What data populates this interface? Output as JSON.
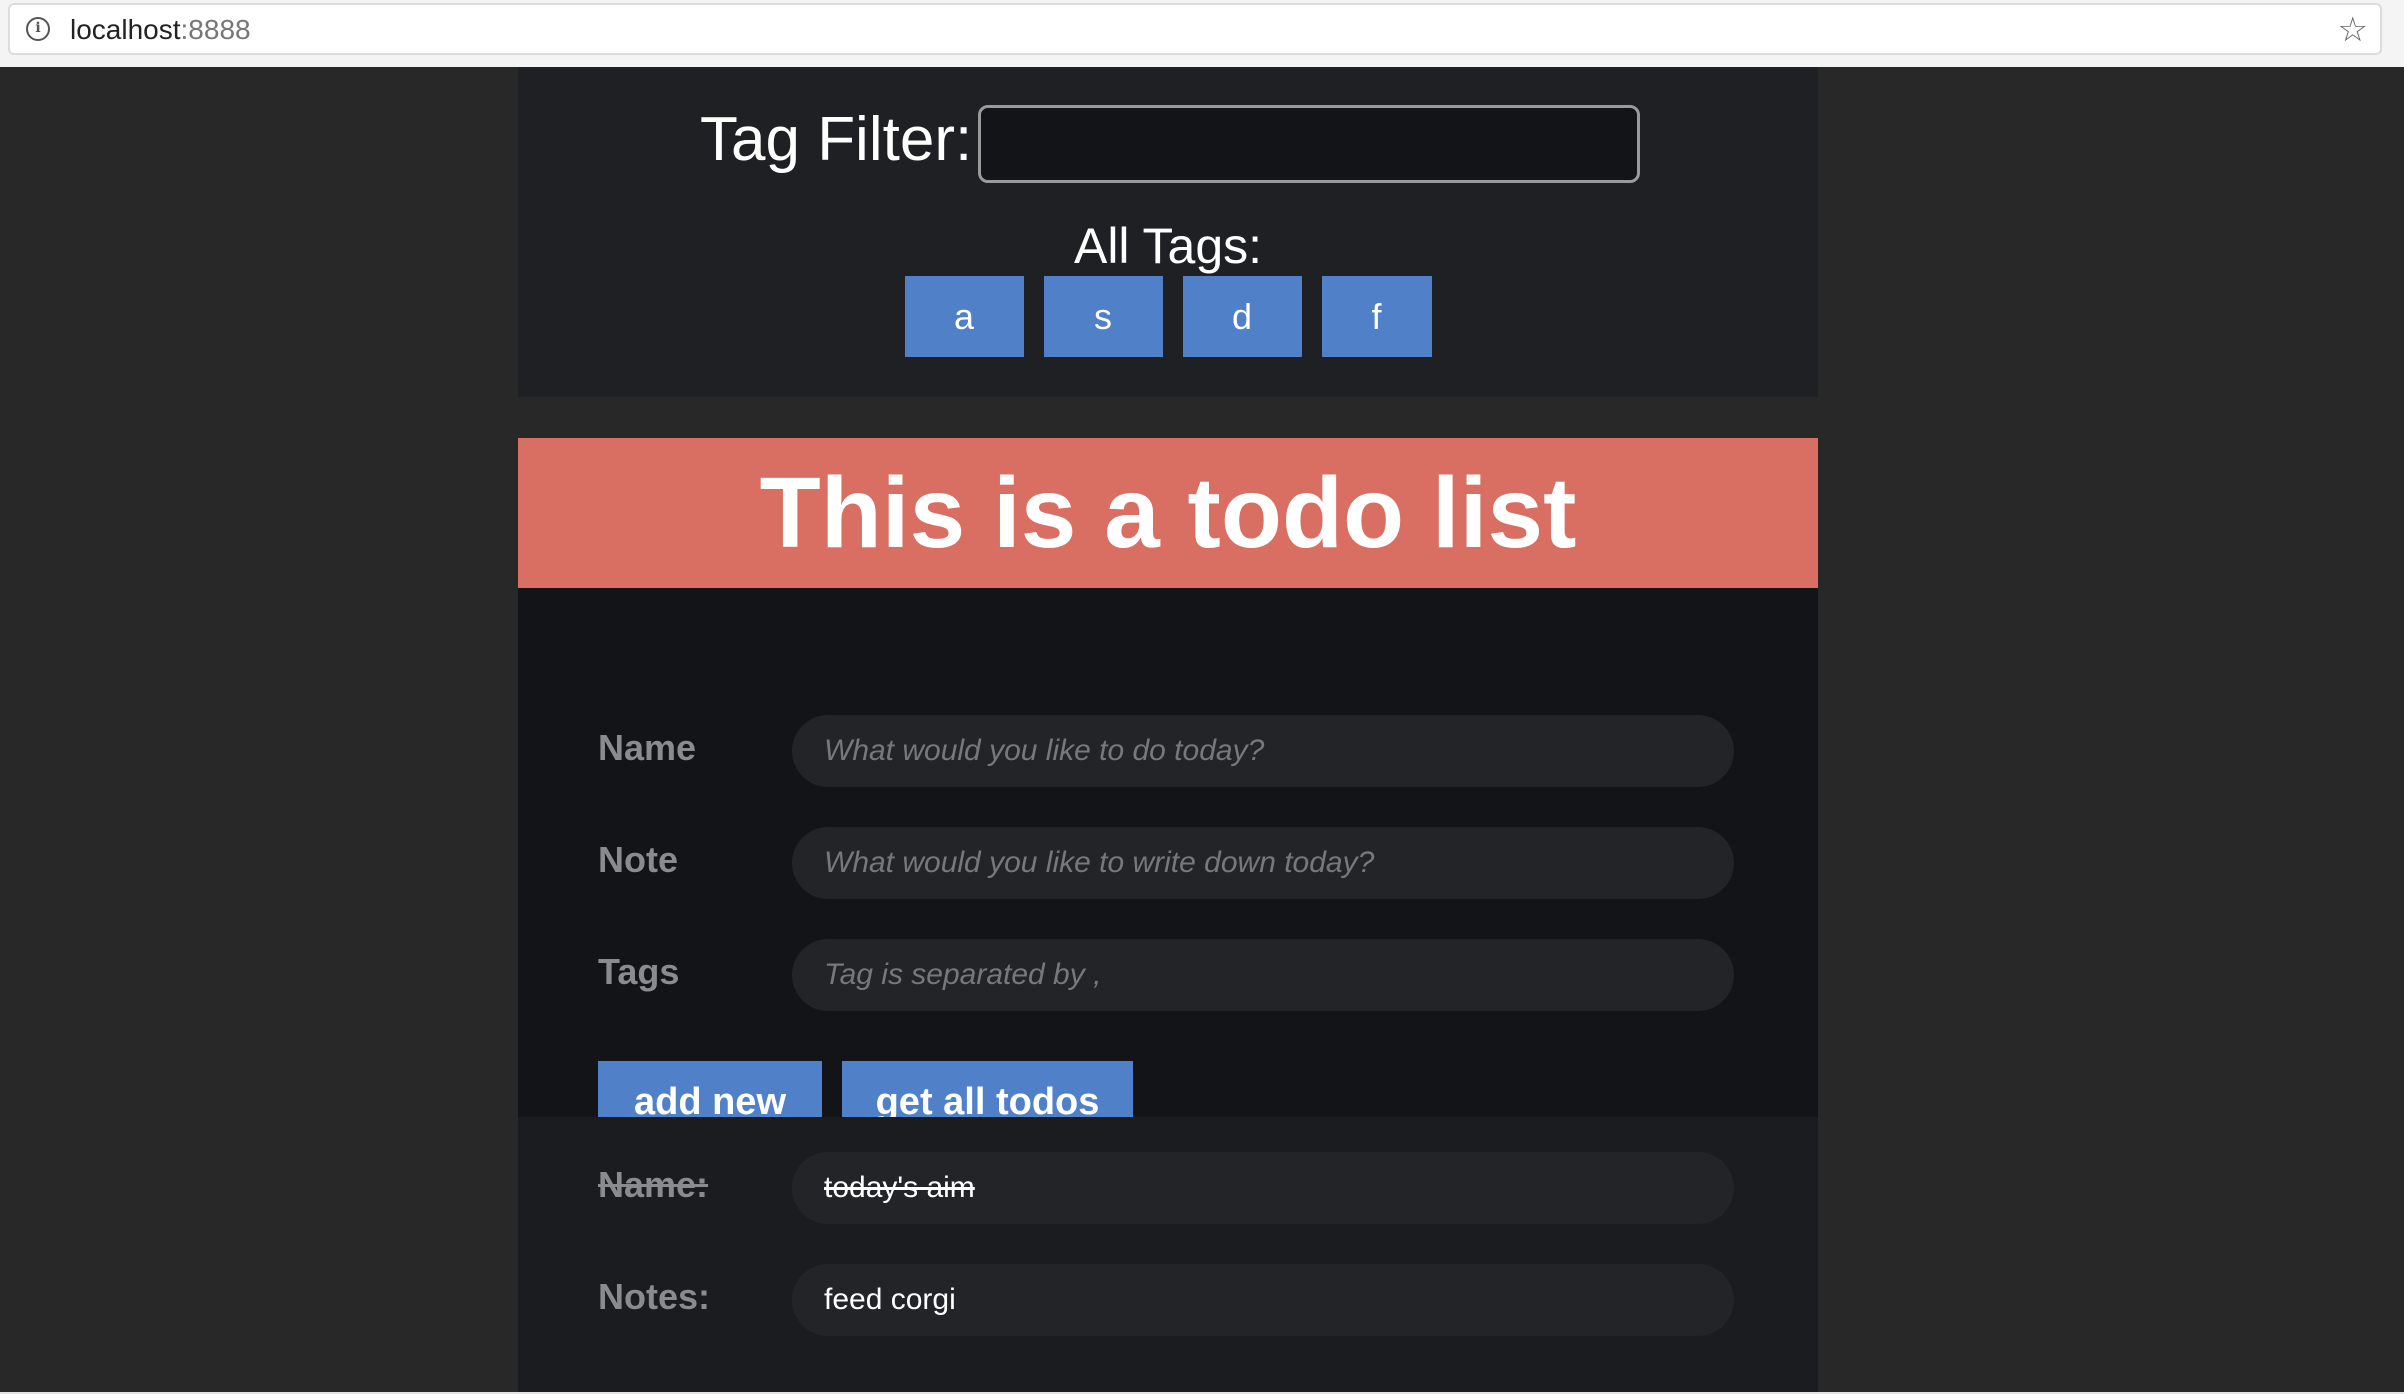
{
  "browser": {
    "url_host": "localhost",
    "url_port": ":8888",
    "info_icon": "info-icon",
    "star_icon": "star-icon"
  },
  "filter": {
    "label": "Tag Filter:",
    "value": "",
    "all_tags_label": "All Tags:",
    "tags": [
      "a",
      "s",
      "d",
      "f"
    ]
  },
  "header": {
    "title": "This is a todo list"
  },
  "form": {
    "name_label": "Name",
    "name_placeholder": "What would you like to do today?",
    "note_label": "Note",
    "note_placeholder": "What would you like to write down today?",
    "tags_label": "Tags",
    "tags_placeholder": "Tag is separated by ,",
    "add_button": "add new",
    "get_all_button": "get all todos"
  },
  "todos": [
    {
      "name_label": "Name:",
      "name": "today's aim",
      "notes_label": "Notes:",
      "notes": "feed corgi",
      "completed": true
    }
  ],
  "colors": {
    "accent_blue": "#5080c8",
    "title_red": "#d96f62",
    "page_bg": "#282829"
  }
}
